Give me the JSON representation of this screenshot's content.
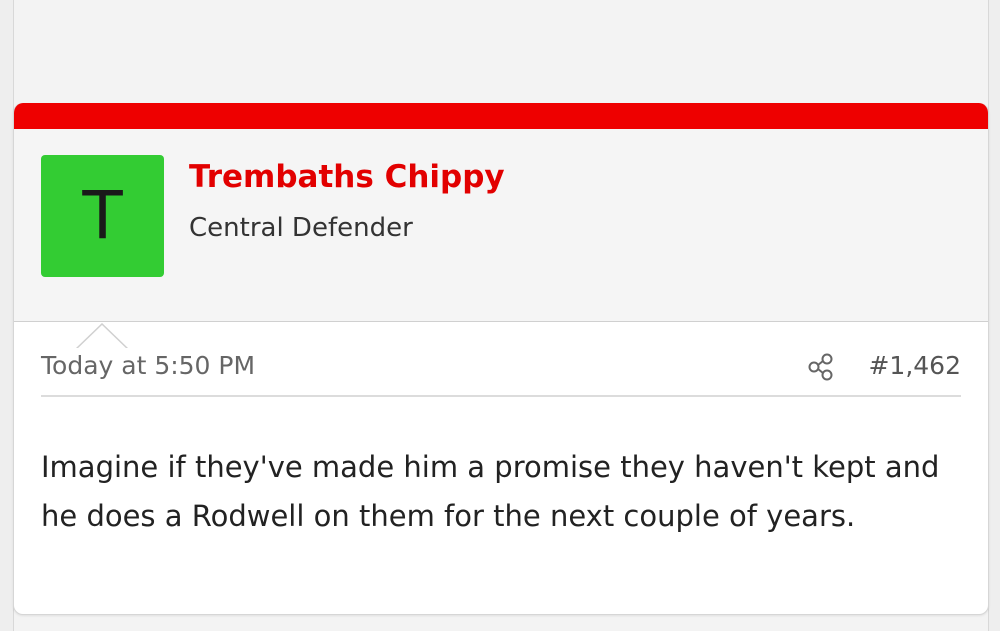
{
  "post": {
    "accent_color": "#ee0000",
    "author": {
      "avatar_letter": "T",
      "avatar_color": "#33cc33",
      "name": "Trembaths Chippy",
      "title": "Central Defender"
    },
    "meta": {
      "date": "Today at 5:50 PM",
      "share_icon": "share-icon",
      "post_number": "#1,462"
    },
    "body": "Imagine if they've made him a promise they haven't kept and he does a Rodwell on them for the next couple of years."
  }
}
